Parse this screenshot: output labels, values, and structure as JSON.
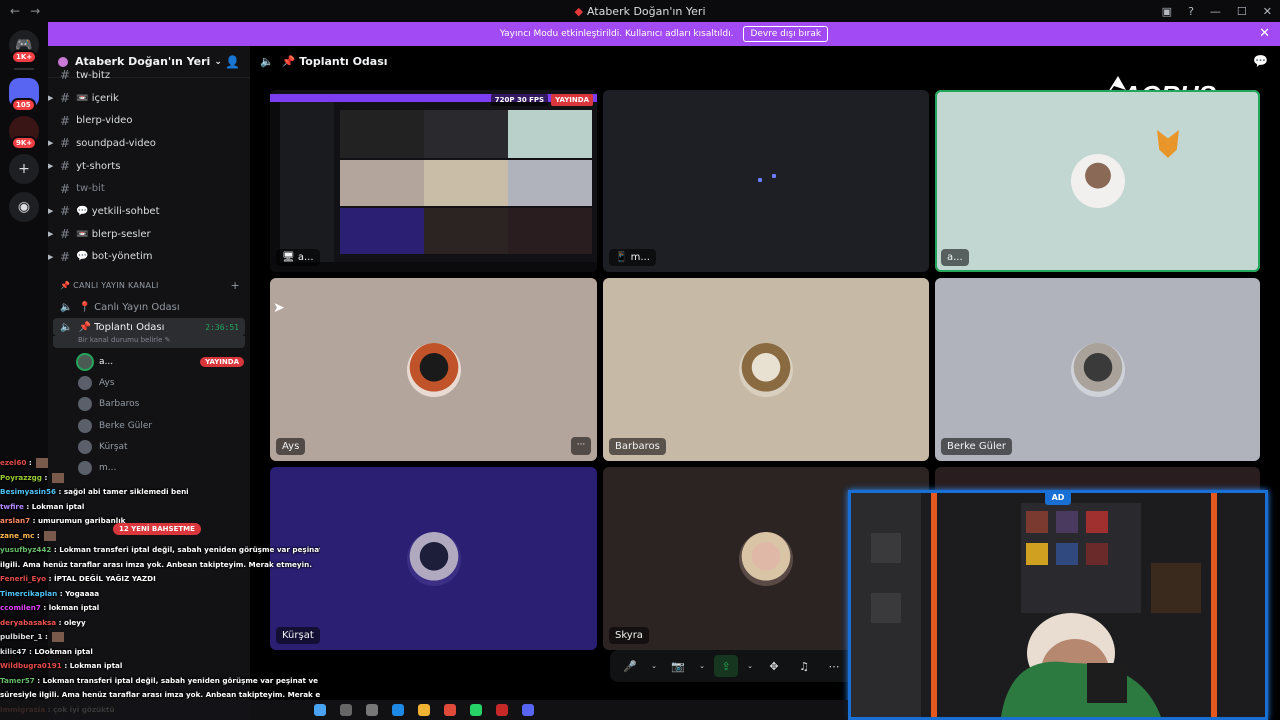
{
  "window": {
    "title": "Ataberk Doğan'ın Yeri",
    "back": "←",
    "forward": "→"
  },
  "banner": {
    "text": "Yayıncı Modu etkinleştirildi. Kullanıcı adları kısaltıldı.",
    "button": "Devre dışı bırak"
  },
  "rail": {
    "badges": [
      "1K+",
      "105",
      "9K+"
    ]
  },
  "server": {
    "name": "Ataberk Doğan'ın Yeri"
  },
  "channels": [
    {
      "name": "tw-bitz",
      "icon": "#",
      "muted": false,
      "caret": false
    },
    {
      "name": "📼 içerik",
      "icon": "#",
      "muted": false,
      "caret": true
    },
    {
      "name": "blerp-video",
      "icon": "#",
      "muted": false,
      "caret": false
    },
    {
      "name": "soundpad-video",
      "icon": "#",
      "muted": false,
      "caret": true
    },
    {
      "name": "yt-shorts",
      "icon": "#",
      "muted": false,
      "caret": true
    },
    {
      "name": "tw-bit",
      "icon": "#",
      "muted": true,
      "caret": false
    },
    {
      "name": "💬 yetkili-sohbet",
      "icon": "#",
      "muted": false,
      "caret": true
    },
    {
      "name": "📼 blerp-sesler",
      "icon": "#",
      "muted": false,
      "caret": true
    },
    {
      "name": "💬 bot-yönetim",
      "icon": "#",
      "muted": false,
      "caret": true
    }
  ],
  "voice_category": "📌 CANLI YAYIN KANALI",
  "voice_channels": {
    "first": "📍 Canlı Yayın Odası",
    "active": "📌 Toplantı Odası",
    "timer": "2:36:51",
    "status": "Bir kanal durumu belirle ✎"
  },
  "members": [
    {
      "name": "a...",
      "live": "YAYINDA"
    },
    {
      "name": "Ays",
      "live": ""
    },
    {
      "name": "Barbaros",
      "live": ""
    },
    {
      "name": "Berke Güler",
      "live": ""
    },
    {
      "name": "Kürşat",
      "live": ""
    },
    {
      "name": "m...",
      "live": ""
    }
  ],
  "main": {
    "title": "📌 Toplantı Odası"
  },
  "tiles": {
    "t1": {
      "name": "a...",
      "res": "720P 30 FPS",
      "live": "YAYINDA"
    },
    "t2": {
      "name": "m..."
    },
    "t3": {
      "name": "a..."
    },
    "t4": {
      "name": "Ays",
      "more": "···"
    },
    "t5": {
      "name": "Barbaros"
    },
    "t6": {
      "name": "Berke Güler"
    },
    "t7": {
      "name": "Kürşat"
    },
    "t8": {
      "name": "Skyra"
    }
  },
  "chat": [
    {
      "user": "ezel60",
      "msg": "",
      "color": "#e34b4b",
      "emote": true
    },
    {
      "user": "Poyrazzgg",
      "msg": "",
      "color": "#9acd32",
      "emote": true
    },
    {
      "user": "Besimyasin56",
      "msg": "sağol abi tamer siklemedi beni",
      "color": "#4fc3f7",
      "emote": false
    },
    {
      "user": "twfire",
      "msg": "Lokman iptal",
      "color": "#b388ff",
      "emote": false
    },
    {
      "user": "arslan7",
      "msg": "umurumun garibanlık",
      "color": "#ff8a65",
      "emote": false
    },
    {
      "user": "zane_mc",
      "msg": "",
      "color": "#ffb74d",
      "emote": true
    },
    {
      "user": "yusufbyz442",
      "msg": "Lokman transferi iptal değil, sabah yeniden görüşme var peşinat ve öder",
      "color": "#66bb6a",
      "emote": false
    },
    {
      "user": "",
      "msg": "ilgili. Ama henüz taraflar arası imza yok. Anbean takipteyim. Merak etmeyin.",
      "color": "#ffffff",
      "emote": false
    },
    {
      "user": "Fenerli_Eyo",
      "msg": "İPTAL DEĞİL YAĞIZ YAZDI",
      "color": "#e34b4b",
      "emote": false
    },
    {
      "user": "Timercikaplan",
      "msg": "Yogaaaa",
      "color": "#4fc3f7",
      "emote": false
    },
    {
      "user": "ccomilen7",
      "msg": "lokman iptal",
      "color": "#e040fb",
      "emote": false
    },
    {
      "user": "deryabasaksa",
      "msg": "oleyy",
      "color": "#ef5350",
      "emote": false
    },
    {
      "user": "pulbiber_1",
      "msg": "",
      "color": "#dbdee1",
      "emote": true
    },
    {
      "user": "kilic47",
      "msg": "LOokman iptal",
      "color": "#dbdee1",
      "emote": false
    },
    {
      "user": "Wildbugra0191",
      "msg": "Lokman iptal",
      "color": "#e34b4b",
      "emote": false
    },
    {
      "user": "Tamer57",
      "msg": "Lokman transferi iptal değil, sabah yeniden görüşme var peşinat ve ö",
      "color": "#66bb6a",
      "emote": false
    },
    {
      "user": "",
      "msg": "süresiyle ilgili. Ama henüz taraflar arası imza yok. Anbean takipteyim. Merak etmeyin.",
      "color": "#ffffff",
      "emote": false
    },
    {
      "user": "Immigrasia",
      "msg": "çok iyi gözüktü",
      "color": "#ff8a65",
      "emote": false
    }
  ],
  "mention": "12 YENİ BAHSETME",
  "aorus": "AORUS",
  "webcam_logo": "AD"
}
